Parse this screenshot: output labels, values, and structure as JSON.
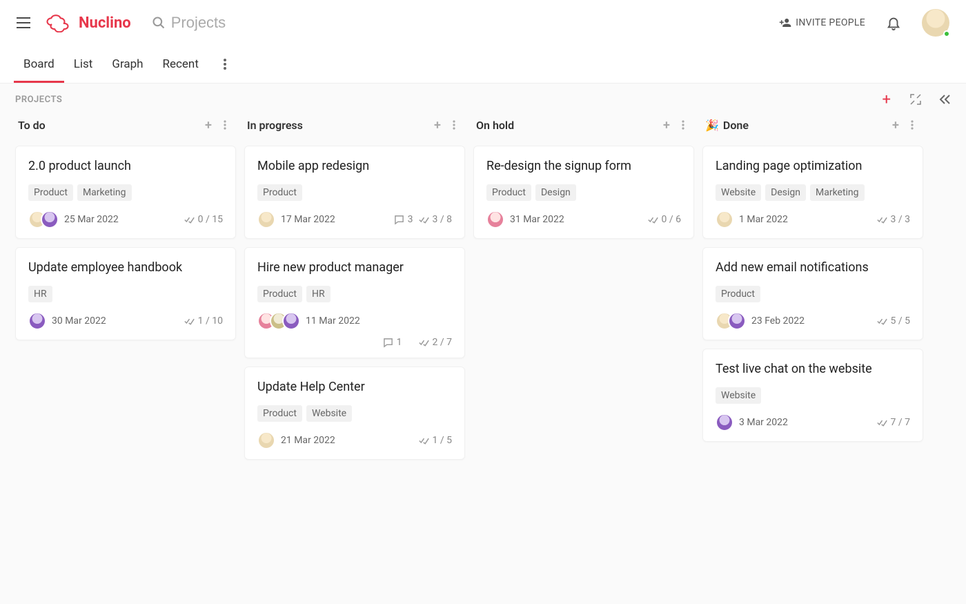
{
  "header": {
    "brand": "Nuclino",
    "search_placeholder": "Projects",
    "invite_label": "INVITE PEOPLE"
  },
  "tabs": {
    "items": [
      "Board",
      "List",
      "Graph",
      "Recent"
    ],
    "active": 0
  },
  "board": {
    "title": "PROJECTS"
  },
  "columns": [
    {
      "title": "To do",
      "emoji": "",
      "cards": [
        {
          "title": "2.0 product launch",
          "tags": [
            "Product",
            "Marketing"
          ],
          "avatars": [
            "a",
            "b"
          ],
          "date": "25 Mar 2022",
          "comments": null,
          "tasks": "0 / 15"
        },
        {
          "title": "Update employee handbook",
          "tags": [
            "HR"
          ],
          "avatars": [
            "b"
          ],
          "date": "30 Mar 2022",
          "comments": null,
          "tasks": "1 / 10"
        }
      ]
    },
    {
      "title": "In progress",
      "emoji": "",
      "cards": [
        {
          "title": "Mobile app redesign",
          "tags": [
            "Product"
          ],
          "avatars": [
            "a"
          ],
          "date": "17 Mar 2022",
          "comments": "3",
          "tasks": "3 / 8"
        },
        {
          "title": "Hire new product manager",
          "tags": [
            "Product",
            "HR"
          ],
          "avatars": [
            "c",
            "d",
            "b"
          ],
          "date": "11 Mar 2022",
          "comments": "1",
          "tasks": "2 / 7",
          "wrap_meta": true
        },
        {
          "title": "Update Help Center",
          "tags": [
            "Product",
            "Website"
          ],
          "avatars": [
            "a"
          ],
          "date": "21 Mar 2022",
          "comments": null,
          "tasks": "1 / 5"
        }
      ]
    },
    {
      "title": "On hold",
      "emoji": "",
      "cards": [
        {
          "title": "Re-design the signup form",
          "tags": [
            "Product",
            "Design"
          ],
          "avatars": [
            "c"
          ],
          "date": "31 Mar 2022",
          "comments": null,
          "tasks": "0 / 6"
        }
      ]
    },
    {
      "title": "Done",
      "emoji": "🎉",
      "cards": [
        {
          "title": "Landing page optimization",
          "tags": [
            "Website",
            "Design",
            "Marketing"
          ],
          "avatars": [
            "a"
          ],
          "date": "1 Mar 2022",
          "comments": null,
          "tasks": "3 / 3"
        },
        {
          "title": "Add new email notifications",
          "tags": [
            "Product"
          ],
          "avatars": [
            "a",
            "b"
          ],
          "date": "23 Feb 2022",
          "comments": null,
          "tasks": "5 / 5"
        },
        {
          "title": "Test live chat on the website",
          "tags": [
            "Website"
          ],
          "avatars": [
            "b"
          ],
          "date": "3 Mar 2022",
          "comments": null,
          "tasks": "7 / 7"
        }
      ]
    }
  ]
}
